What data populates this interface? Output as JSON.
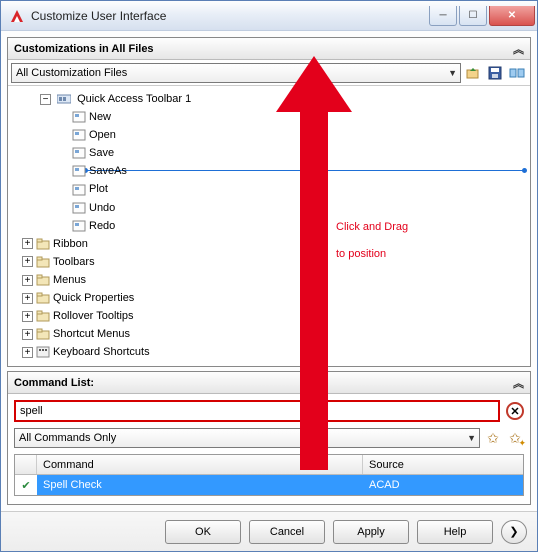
{
  "window": {
    "title": "Customize User Interface"
  },
  "panel1": {
    "title": "Customizations in All Files",
    "dropdown": "All Customization Files",
    "tree": {
      "quick_access": {
        "label": "Quick Access Toolbar 1",
        "items": [
          "New",
          "Open",
          "Save",
          "SaveAs",
          "Plot",
          "Undo",
          "Redo"
        ]
      },
      "others": [
        "Ribbon",
        "Toolbars",
        "Menus",
        "Quick Properties",
        "Rollover Tooltips",
        "Shortcut Menus",
        "Keyboard Shortcuts"
      ]
    }
  },
  "panel2": {
    "title": "Command List:",
    "search_value": "spell",
    "filter": "All Commands Only",
    "columns": {
      "command": "Command",
      "source": "Source"
    },
    "row": {
      "command": "Spell Check",
      "source": "ACAD"
    }
  },
  "buttons": {
    "ok": "OK",
    "cancel": "Cancel",
    "apply": "Apply",
    "help": "Help"
  },
  "annotation": {
    "line1": "Click and Drag",
    "line2": "to position"
  },
  "icons": {
    "expand": "+",
    "collapse": "−",
    "chev": "︽",
    "caret": "▼",
    "arrow_r": "❯",
    "check": "✔",
    "clear": "✕"
  }
}
